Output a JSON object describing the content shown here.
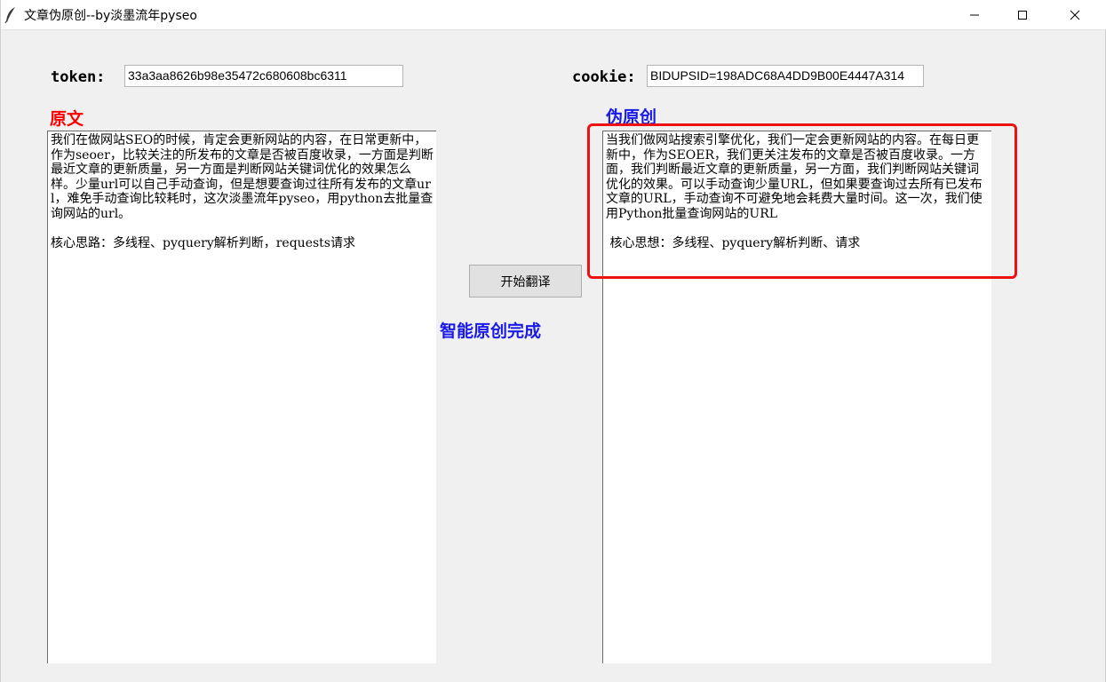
{
  "window": {
    "title": "文章伪原创--by淡墨流年pyseo",
    "icon": "feather-icon",
    "controls": [
      "minimize-icon",
      "maximize-icon",
      "close-icon"
    ]
  },
  "form": {
    "token_label": "token:",
    "token_value": "33a3aa8626b98e35472c680608bc6311",
    "cookie_label": "cookie:",
    "cookie_value": "BIDUPSID=198ADC68A4DD9B00E4447A314"
  },
  "original": {
    "heading": "原文",
    "text": "我们在做网站SEO的时候，肯定会更新网站的内容，在日常更新中，作为seoer，比较关注的所发布的文章是否被百度收录，一方面是判断最近文章的更新质量，另一方面是判断网站关键词优化的效果怎么样。少量url可以自己手动查询，但是想要查询过往所有发布的文章url，难免手动查询比较耗时，这次淡墨流年pyseo，用python去批量查询网站的url。\n\n核心思路：多线程、pyquery解析判断，requests请求"
  },
  "rewrite": {
    "heading": "伪原创",
    "text": "当我们做网站搜索引擎优化，我们一定会更新网站的内容。在每日更新中，作为SEOER，我们更关注发布的文章是否被百度收录。一方面，我们判断最近文章的更新质量，另一方面，我们判断网站关键词优化的效果。可以手动查询少量URL，但如果要查询过去所有已发布文章的URL，手动查询不可避免地会耗费大量时间。这一次，我们使用Python批量查询网站的URL\n\n 核心思想：多线程、pyquery解析判断、请求"
  },
  "actions": {
    "translate_label": "开始翻译",
    "status_text": "智能原创完成"
  },
  "colors": {
    "original_heading": "#ff0000",
    "rewrite_heading": "#1a1ae6",
    "status": "#1a1ae6",
    "highlight_box": "#ee1111"
  }
}
